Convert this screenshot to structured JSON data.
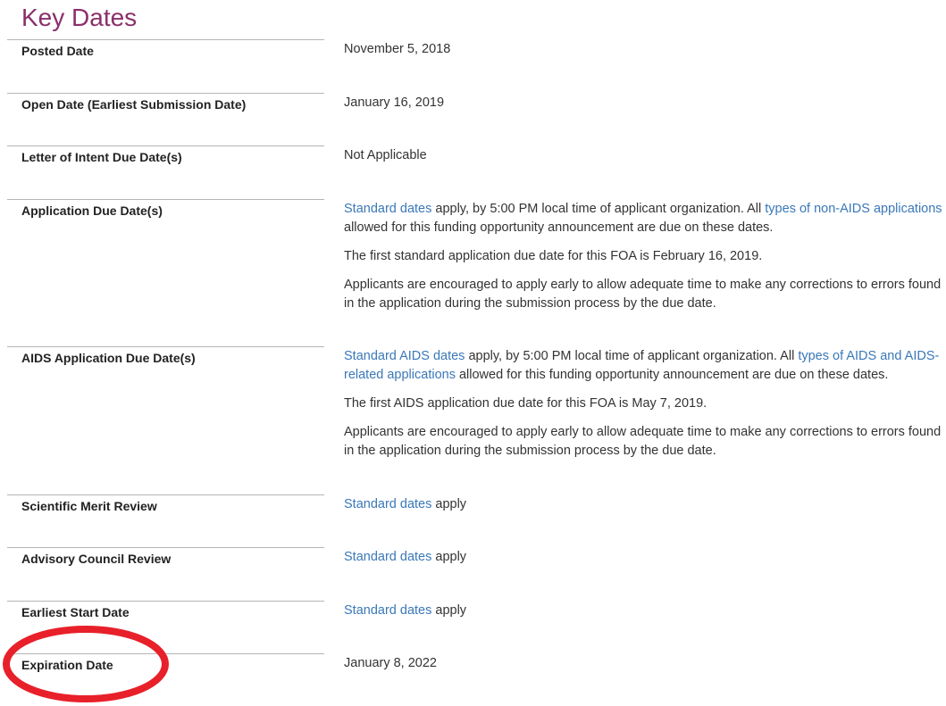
{
  "section_title": "Key Dates",
  "rows": [
    {
      "label": "Posted Date",
      "value": "November 5, 2018"
    },
    {
      "label": "Open Date (Earliest Submission Date)",
      "value": "January 16, 2019"
    },
    {
      "label": "Letter of Intent Due Date(s)",
      "value": "Not Applicable"
    },
    {
      "label": "Application Due Date(s)",
      "p1": {
        "link1": "Standard dates",
        "text1": " apply, by 5:00 PM local time of applicant organization. All ",
        "link2": "types of non-AIDS applications",
        "text2": " allowed for this funding opportunity announcement are due on these dates."
      },
      "p2": "The first standard application due date for this FOA is February 16, 2019.",
      "p3": "Applicants are encouraged to apply early to allow adequate time to make any corrections to errors found in the application during the submission process by the due date."
    },
    {
      "label": "AIDS Application Due Date(s)",
      "p1": {
        "link1": "Standard AIDS dates",
        "text1": " apply, by 5:00 PM local time of applicant organization. All ",
        "link2": "types of AIDS and AIDS-related applications",
        "text2": " allowed for this funding opportunity announcement are due on these dates."
      },
      "p2": "The first AIDS application due date for this FOA is May 7, 2019.",
      "p3": "Applicants are encouraged to apply early to allow adequate time to make any corrections to errors found in the application during the submission process by the due date."
    },
    {
      "label": "Scientific Merit Review",
      "link": "Standard dates",
      "text": " apply"
    },
    {
      "label": "Advisory Council Review",
      "link": "Standard dates",
      "text": " apply"
    },
    {
      "label": "Earliest Start Date",
      "link": "Standard dates",
      "text": " apply"
    },
    {
      "label": "Expiration Date",
      "value": "January 8, 2022"
    }
  ],
  "annotation": {
    "shape": "ellipse",
    "color": "#e8202a",
    "highlights": "Expiration Date"
  }
}
